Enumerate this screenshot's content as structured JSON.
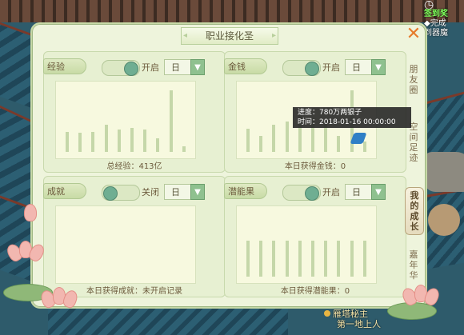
{
  "panel": {
    "title": "职业接化圣"
  },
  "cards": [
    {
      "label": "经验",
      "toggle_state": "开启",
      "toggle_on": true,
      "period": "日",
      "footer": "总经验：413亿",
      "bars": [
        0.3,
        0.28,
        0.3,
        0.4,
        0.33,
        0.36,
        0.33,
        0.2,
        0.92,
        0.08
      ]
    },
    {
      "label": "金钱",
      "toggle_state": "开启",
      "toggle_on": true,
      "period": "日",
      "footer": "本日获得金钱：0",
      "bars": [
        0.34,
        0.24,
        0.41,
        0.45,
        0.55,
        0.5,
        0.46,
        0.24,
        0.92,
        0.15
      ]
    },
    {
      "label": "成就",
      "toggle_state": "关闭",
      "toggle_on": false,
      "period": "日",
      "footer": "本日获得成就：未开启记录",
      "bars": []
    },
    {
      "label": "潜能果",
      "toggle_state": "开启",
      "toggle_on": true,
      "period": "日",
      "footer": "本日获得潜能果：0",
      "bars": [
        0.54,
        0.54,
        0.54,
        0.54,
        0.54,
        0.54,
        0.54,
        0.54,
        0.54,
        0.54
      ]
    }
  ],
  "side_tabs": [
    {
      "label": "朋友圈",
      "chars": [
        "朋",
        "友",
        "圈"
      ],
      "active": false
    },
    {
      "label": "空间足迹",
      "chars": [
        "空",
        "间",
        "足",
        "迹"
      ],
      "active": false
    },
    {
      "label": "我的成长",
      "chars": [
        "我",
        "的",
        "成",
        "长"
      ],
      "active": true
    },
    {
      "label": "嘉年华",
      "chars": [
        "嘉",
        "年",
        "华"
      ],
      "active": false
    }
  ],
  "tooltip": {
    "line1": "进度：780万两银子",
    "line2": "时间：2018-01-16 00:00:00"
  },
  "hud": {
    "line1": "签到奖",
    "line2": "◆完成",
    "line3": "到器魔",
    "bottom1": "雁塔秘主",
    "bottom2": "第一地上人"
  }
}
